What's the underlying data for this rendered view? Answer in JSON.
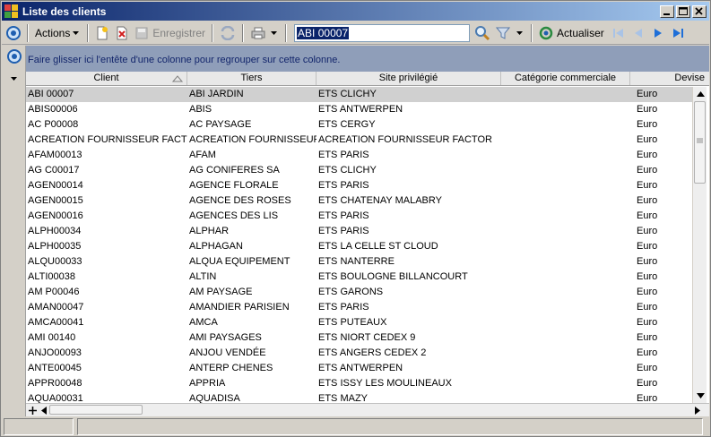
{
  "window": {
    "title": "Liste des clients"
  },
  "toolbar": {
    "actions_label": "Actions",
    "save_label": "Enregistrer",
    "search_value": "ABI 00007",
    "refresh_label": "Actualiser"
  },
  "grid": {
    "group_hint": "Faire glisser ici l'entête d'une colonne pour regrouper sur cette colonne.",
    "columns": [
      "Client",
      "Tiers",
      "Site privilégié",
      "Catégorie commerciale",
      "Devise"
    ],
    "rows": [
      [
        "ABI 00007",
        "ABI JARDIN",
        "ETS CLICHY",
        "",
        "Euro"
      ],
      [
        "ABIS00006",
        "ABIS",
        "ETS ANTWERPEN",
        "",
        "Euro"
      ],
      [
        "AC P00008",
        "AC PAYSAGE",
        "ETS CERGY",
        "",
        "Euro"
      ],
      [
        "ACREATION FOURNISSEUR FACTOR",
        "ACREATION FOURNISSEUR F",
        "ACREATION FOURNISSEUR FACTOR",
        "",
        "Euro"
      ],
      [
        "AFAM00013",
        "AFAM",
        "ETS PARIS",
        "",
        "Euro"
      ],
      [
        "AG C00017",
        "AG CONIFERES SA",
        "ETS CLICHY",
        "",
        "Euro"
      ],
      [
        "AGEN00014",
        "AGENCE FLORALE",
        "ETS PARIS",
        "",
        "Euro"
      ],
      [
        "AGEN00015",
        "AGENCE DES ROSES",
        "ETS CHATENAY MALABRY",
        "",
        "Euro"
      ],
      [
        "AGEN00016",
        "AGENCES DES LIS",
        "ETS PARIS",
        "",
        "Euro"
      ],
      [
        "ALPH00034",
        "ALPHAR",
        "ETS PARIS",
        "",
        "Euro"
      ],
      [
        "ALPH00035",
        "ALPHAGAN",
        "ETS LA CELLE ST CLOUD",
        "",
        "Euro"
      ],
      [
        "ALQU00033",
        "ALQUA EQUIPEMENT",
        "ETS NANTERRE",
        "",
        "Euro"
      ],
      [
        "ALTI00038",
        "ALTIN",
        "ETS BOULOGNE BILLANCOURT",
        "",
        "Euro"
      ],
      [
        "AM P00046",
        "AM PAYSAGE",
        "ETS GARONS",
        "",
        "Euro"
      ],
      [
        "AMAN00047",
        "AMANDIER PARISIEN",
        "ETS PARIS",
        "",
        "Euro"
      ],
      [
        "AMCA00041",
        "AMCA",
        "ETS PUTEAUX",
        "",
        "Euro"
      ],
      [
        "AMI 00140",
        "AMI PAYSAGES",
        "ETS NIORT CEDEX 9",
        "",
        "Euro"
      ],
      [
        "ANJO00093",
        "ANJOU VENDÉE",
        "ETS ANGERS CEDEX 2",
        "",
        "Euro"
      ],
      [
        "ANTE00045",
        "ANTERP CHENES",
        "ETS ANTWERPEN",
        "",
        "Euro"
      ],
      [
        "APPR00048",
        "APPRIA",
        "ETS ISSY LES MOULINEAUX",
        "",
        "Euro"
      ],
      [
        "AQUA00031",
        "AQUADISA",
        "ETS MAZY",
        "",
        "Euro"
      ]
    ]
  },
  "icons": {
    "colors": {
      "accent_blue": "#1f5fb0",
      "nav_blue": "#1e6fd8",
      "group_panel": "#8f9eb9"
    }
  }
}
